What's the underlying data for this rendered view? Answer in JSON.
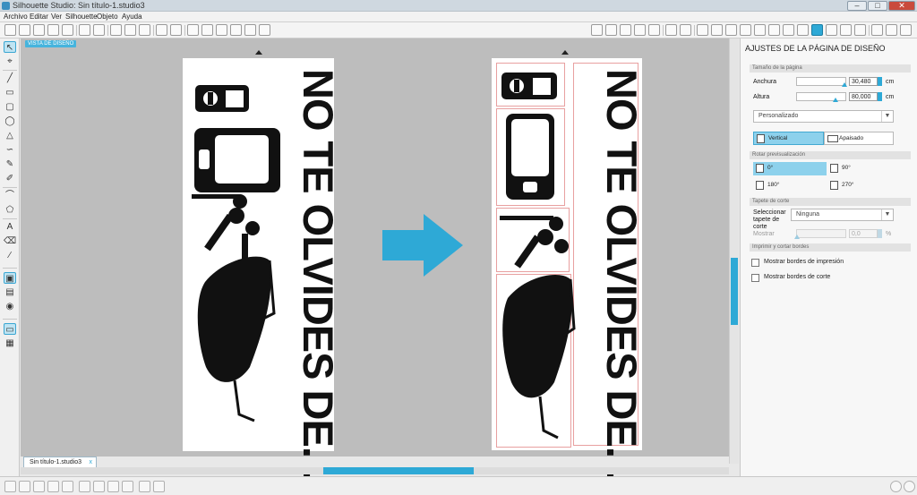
{
  "window": {
    "title": "Silhouette Studio: Sin título-1.studio3",
    "controls": {
      "minimize": "–",
      "maximize": "□",
      "close": "✕"
    }
  },
  "menu": [
    "Archivo",
    "Editar",
    "Ver",
    "Silhouette",
    "Objeto",
    "Ayuda"
  ],
  "canvas": {
    "view_label": "VISTA DE DISEÑO",
    "poster_text": "NO TE OLVIDES DE..."
  },
  "tabs": {
    "doc": "Sin título-1.studio3",
    "close": "x"
  },
  "panel": {
    "title": "AJUSTES DE LA PÁGINA DE DISEÑO",
    "page_size": {
      "header": "Tamaño de la página",
      "width_label": "Anchura",
      "width_value": "30,480",
      "width_level": 0.98,
      "height_label": "Altura",
      "height_value": "80,000",
      "height_level": 0.8,
      "unit": "cm",
      "preset": "Personalizado",
      "orientation_vertical": "Vertical",
      "orientation_horizontal": "Apaisado"
    },
    "rotation": {
      "header": "Rotar previsualización",
      "options": [
        "0°",
        "90°",
        "180°",
        "270°"
      ],
      "selected": "0°"
    },
    "cutting_mat": {
      "header": "Tapete de corte",
      "select_label": "Seleccionar tapete de corte",
      "select_value": "Ninguna",
      "show_label": "Mostrar",
      "show_value": "0,0",
      "percent": "%"
    },
    "borders": {
      "header": "Imprimir y cortar bordes",
      "print": "Mostrar bordes de impresión",
      "cut": "Mostrar bordes de corte"
    }
  },
  "colors": {
    "accent": "#2ea9d6",
    "arrow": "#2ea9d6"
  }
}
